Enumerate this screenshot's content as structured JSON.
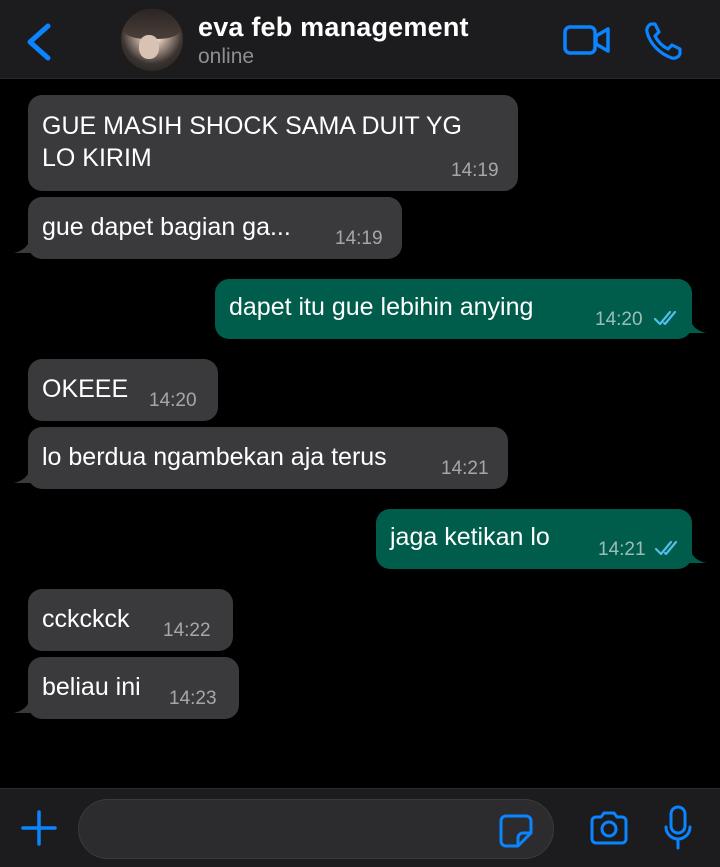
{
  "header": {
    "contact_name": "eva feb management",
    "status": "online",
    "icons": [
      "chevron-left-icon",
      "video-call-icon",
      "phone-icon"
    ],
    "accent_color": "#0a84ff"
  },
  "messages": [
    {
      "direction": "incoming",
      "lines": [
        "GUE MASIH SHOCK SAMA DUIT YG",
        "LO KIRIM"
      ],
      "time": "14:19"
    },
    {
      "direction": "incoming",
      "text": "gue dapet bagian ga...",
      "time": "14:19"
    },
    {
      "direction": "outgoing",
      "text": "dapet itu gue lebihin anying",
      "time": "14:20",
      "read": true
    },
    {
      "direction": "incoming",
      "text": "OKEEE",
      "time": "14:20"
    },
    {
      "direction": "incoming",
      "text": "lo berdua ngambekan aja terus",
      "time": "14:21"
    },
    {
      "direction": "outgoing",
      "text": "jaga ketikan lo",
      "time": "14:21",
      "read": true
    },
    {
      "direction": "incoming",
      "text": "cckckck",
      "time": "14:22"
    },
    {
      "direction": "incoming",
      "text": "beliau ini",
      "time": "14:23"
    }
  ],
  "colors": {
    "incoming_bubble": "#3a3a3c",
    "outgoing_bubble": "#005c4b",
    "read_ticks": "#53bdeb"
  },
  "composer": {
    "placeholder": "",
    "icons": [
      "plus-icon",
      "sticker-icon",
      "camera-icon",
      "microphone-icon"
    ]
  }
}
